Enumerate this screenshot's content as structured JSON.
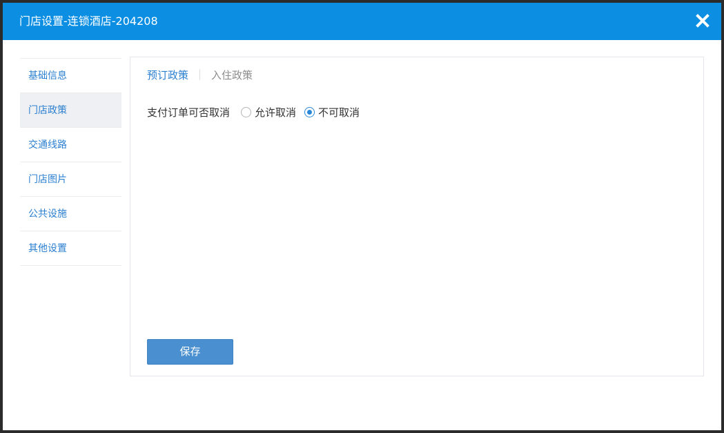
{
  "window": {
    "title": "门店设置-连锁酒店-204208",
    "close_icon": "close-icon"
  },
  "sidebar": {
    "items": [
      {
        "label": "基础信息",
        "active": false
      },
      {
        "label": "门店政策",
        "active": true
      },
      {
        "label": "交通线路",
        "active": false
      },
      {
        "label": "门店图片",
        "active": false
      },
      {
        "label": "公共设施",
        "active": false
      },
      {
        "label": "其他设置",
        "active": false
      }
    ]
  },
  "main": {
    "tabs": [
      {
        "label": "预订政策",
        "active": true
      },
      {
        "label": "入住政策",
        "active": false
      }
    ],
    "cancel_policy": {
      "label": "支付订单可否取消",
      "options": [
        {
          "label": "允许取消",
          "checked": false
        },
        {
          "label": "不可取消",
          "checked": true
        }
      ]
    },
    "save_label": "保存"
  },
  "colors": {
    "titlebar": "#0c8fe3",
    "accent": "#2b7fd0",
    "button": "#4a8fd0"
  }
}
